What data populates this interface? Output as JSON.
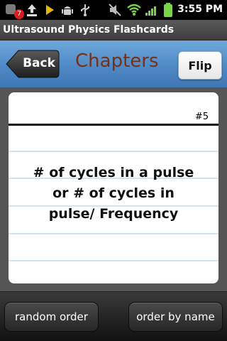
{
  "status_bar": {
    "notification_count": "7",
    "time": "3:55 PM",
    "icons": [
      "notification-badge-icon",
      "upload-icon",
      "play-store-icon",
      "android-icon",
      "usb-icon",
      "mute-icon",
      "wifi-icon",
      "signal-icon",
      "battery-icon"
    ]
  },
  "app": {
    "title": "Ultrasound Physics Flashcards"
  },
  "toolbar": {
    "back_label": "Back",
    "title": "Chapters",
    "flip_label": "Flip"
  },
  "card": {
    "number": "#5",
    "text": "# of cycles in a pulse\nor    # of cycles in\npulse/ Frequency"
  },
  "bottom_bar": {
    "random_order_label": "random order",
    "order_by_name_label": "order by name"
  },
  "colors": {
    "toolbar_blue": "#4f8ac6",
    "chapters_title": "#7a2f12",
    "card_line_blue": "#a9c7ea",
    "battery_green": "#7bd34a"
  }
}
